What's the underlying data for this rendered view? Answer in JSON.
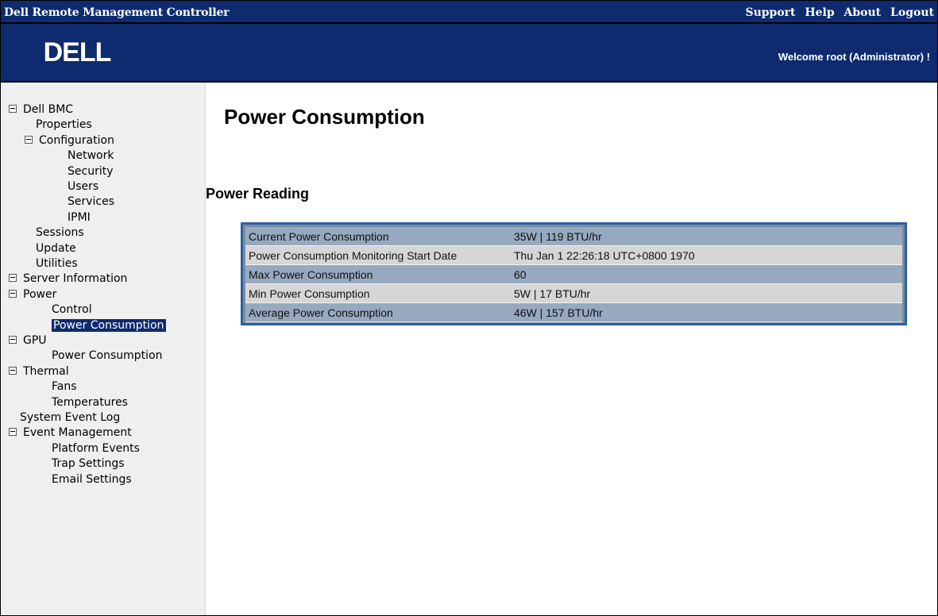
{
  "titlebar": {
    "app_title": "Dell Remote Management Controller",
    "links": [
      "Support",
      "Help",
      "About",
      "Logout"
    ]
  },
  "banner": {
    "logo_text": "DELL",
    "welcome": "Welcome root (Administrator) !"
  },
  "sidebar": {
    "items": [
      {
        "label": "Dell BMC",
        "expanded": true
      },
      {
        "label": "Properties"
      },
      {
        "label": "Configuration",
        "expanded": true
      },
      {
        "label": "Network"
      },
      {
        "label": "Security"
      },
      {
        "label": "Users"
      },
      {
        "label": "Services"
      },
      {
        "label": "IPMI"
      },
      {
        "label": "Sessions"
      },
      {
        "label": "Update"
      },
      {
        "label": "Utilities"
      },
      {
        "label": "Server Information",
        "expanded": true
      },
      {
        "label": "Power",
        "expanded": true
      },
      {
        "label": "Control"
      },
      {
        "label": "Power Consumption",
        "selected": true
      },
      {
        "label": "GPU",
        "expanded": true
      },
      {
        "label": "Power Consumption"
      },
      {
        "label": "Thermal",
        "expanded": true
      },
      {
        "label": "Fans"
      },
      {
        "label": "Temperatures"
      },
      {
        "label": "System Event Log"
      },
      {
        "label": "Event Management",
        "expanded": true
      },
      {
        "label": "Platform Events"
      },
      {
        "label": "Trap Settings"
      },
      {
        "label": "Email Settings"
      }
    ]
  },
  "main": {
    "page_title": "Power Consumption",
    "section_title": "Power Reading",
    "readings": [
      {
        "label": "Current Power Consumption",
        "value": "35W | 119 BTU/hr"
      },
      {
        "label": "Power Consumption Monitoring Start Date",
        "value": "Thu Jan 1 22:26:18 UTC+0800 1970"
      },
      {
        "label": "Max Power Consumption",
        "value": "60"
      },
      {
        "label": "Min Power Consumption",
        "value": "5W | 17 BTU/hr"
      },
      {
        "label": "Average Power Consumption",
        "value": "46W | 157 BTU/hr"
      }
    ]
  },
  "colors": {
    "header_navy": "#0d2b6e",
    "sidebar_bg": "#efefef",
    "table_border": "#2e5f9e",
    "row_blue": "#96a9bf",
    "row_gray": "#d6d6d6"
  }
}
